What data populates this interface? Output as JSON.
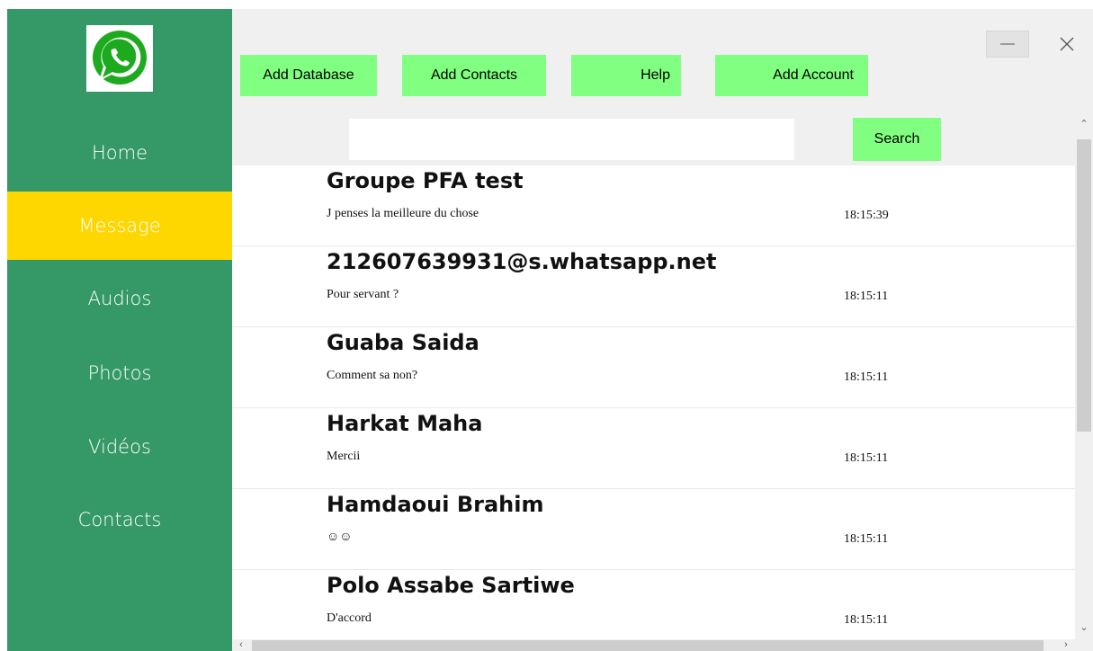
{
  "sidebar": {
    "logo": "whatsapp-logo",
    "items": [
      {
        "label": "Home",
        "active": false
      },
      {
        "label": "Message",
        "active": true
      },
      {
        "label": "Audios",
        "active": false
      },
      {
        "label": "Photos",
        "active": false
      },
      {
        "label": "Vidéos",
        "active": false
      },
      {
        "label": "Contacts",
        "active": false
      }
    ]
  },
  "toolbar": {
    "add_database": "Add Database",
    "add_contacts": "Add Contacts",
    "help": "Help",
    "add_account": "Add Account"
  },
  "search": {
    "value": "",
    "button_label": "Search"
  },
  "messages": [
    {
      "name": "Groupe PFA test",
      "preview": "J penses la meilleure du chose",
      "time": "18:15:39"
    },
    {
      "name": "212607639931@s.whatsapp.net",
      "preview": "Pour servant ?",
      "time": "18:15:11"
    },
    {
      "name": "Guaba Saida",
      "preview": "Comment sa non?",
      "time": "18:15:11"
    },
    {
      "name": "Harkat Maha",
      "preview": "Mercii",
      "time": "18:15:11"
    },
    {
      "name": "Hamdaoui Brahim",
      "preview": "☺☺",
      "time": "18:15:11"
    },
    {
      "name": "Polo Assabe Sartiwe",
      "preview": "D'accord",
      "time": "18:15:11"
    }
  ],
  "colors": {
    "sidebar": "#349966",
    "active_item": "#ffd700",
    "button": "#80ff80",
    "background": "#f0f0f0"
  },
  "icons": {
    "minimize": "minimize-icon",
    "close": "close-icon"
  }
}
